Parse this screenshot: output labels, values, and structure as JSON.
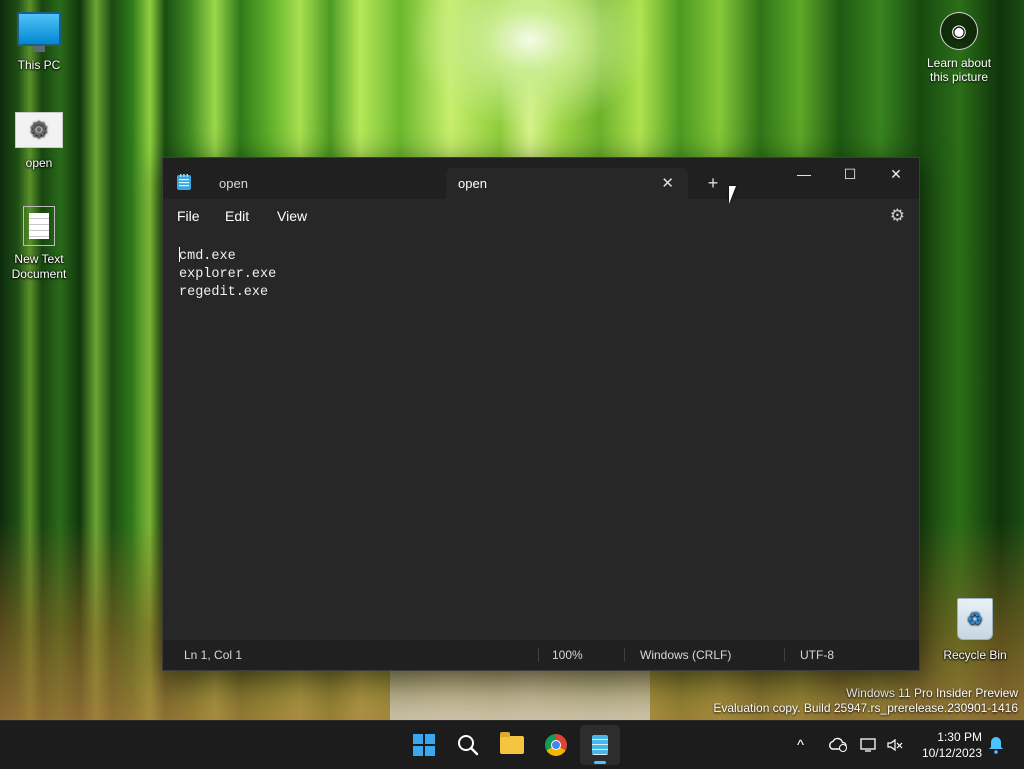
{
  "desktop": {
    "icons": [
      {
        "label": "This PC",
        "icon": "this-pc-icon"
      },
      {
        "label": "open",
        "icon": "gear-file-icon"
      },
      {
        "label": "New Text\nDocument",
        "icon": "text-document-icon"
      },
      {
        "label": "Recycle Bin",
        "icon": "recycle-bin-icon"
      }
    ],
    "learn_label": "Learn about\nthis picture",
    "watermark_line1": "Windows 11 Pro Insider Preview",
    "watermark_line2": "Evaluation copy. Build 25947.rs_prerelease.230901-1416"
  },
  "notepad": {
    "tabs": [
      {
        "label": "open",
        "active": false
      },
      {
        "label": "open",
        "active": true
      }
    ],
    "tab_close": "✕",
    "new_tab": "+",
    "window_controls": {
      "minimize": "—",
      "maximize": "☐",
      "close": "✕"
    },
    "menu": [
      "File",
      "Edit",
      "View"
    ],
    "settings_icon": "gear-icon",
    "content_lines": [
      "cmd.exe",
      "explorer.exe",
      "regedit.exe"
    ],
    "status": {
      "position": "Ln 1, Col 1",
      "zoom": "100%",
      "line_ending": "Windows (CRLF)",
      "encoding": "UTF-8"
    }
  },
  "taskbar": {
    "apps": [
      "start-icon",
      "search-icon",
      "file-explorer-icon",
      "chrome-icon",
      "notepad-icon"
    ],
    "active_app": "notepad-icon",
    "tray": {
      "chevron": "^"
    },
    "time": "1:30 PM",
    "date": "10/12/2023"
  },
  "colors": {
    "window_bg": "#272727",
    "titlebar_bg": "#202020",
    "accent": "#4cc2ff",
    "taskbar_bg": "#1c1c1c"
  }
}
